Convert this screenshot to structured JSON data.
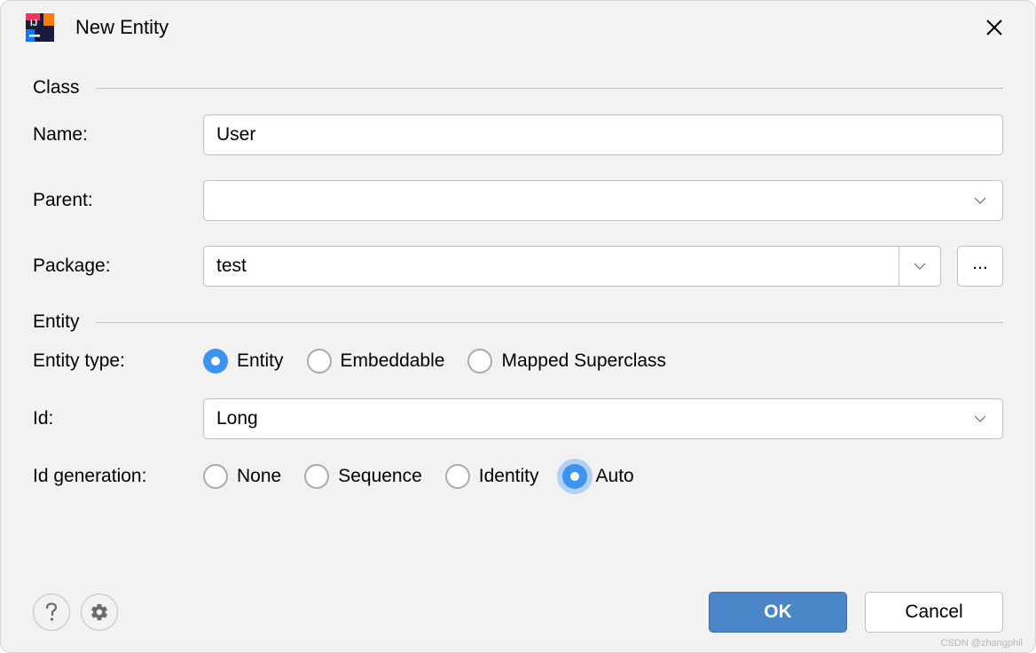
{
  "dialog": {
    "title": "New Entity"
  },
  "sections": {
    "class": "Class",
    "entity": "Entity"
  },
  "fields": {
    "name": {
      "label": "Name:",
      "value": "User"
    },
    "parent": {
      "label": "Parent:",
      "value": ""
    },
    "package": {
      "label": "Package:",
      "value": "test",
      "browse": "..."
    },
    "entityType": {
      "label": "Entity type:",
      "options": [
        "Entity",
        "Embeddable",
        "Mapped Superclass"
      ],
      "selected": "Entity"
    },
    "id": {
      "label": "Id:",
      "value": "Long"
    },
    "idGeneration": {
      "label": "Id generation:",
      "options": [
        "None",
        "Sequence",
        "Identity",
        "Auto"
      ],
      "selected": "Auto"
    }
  },
  "buttons": {
    "ok": "OK",
    "cancel": "Cancel"
  },
  "watermark": "CSDN @zhangphil"
}
